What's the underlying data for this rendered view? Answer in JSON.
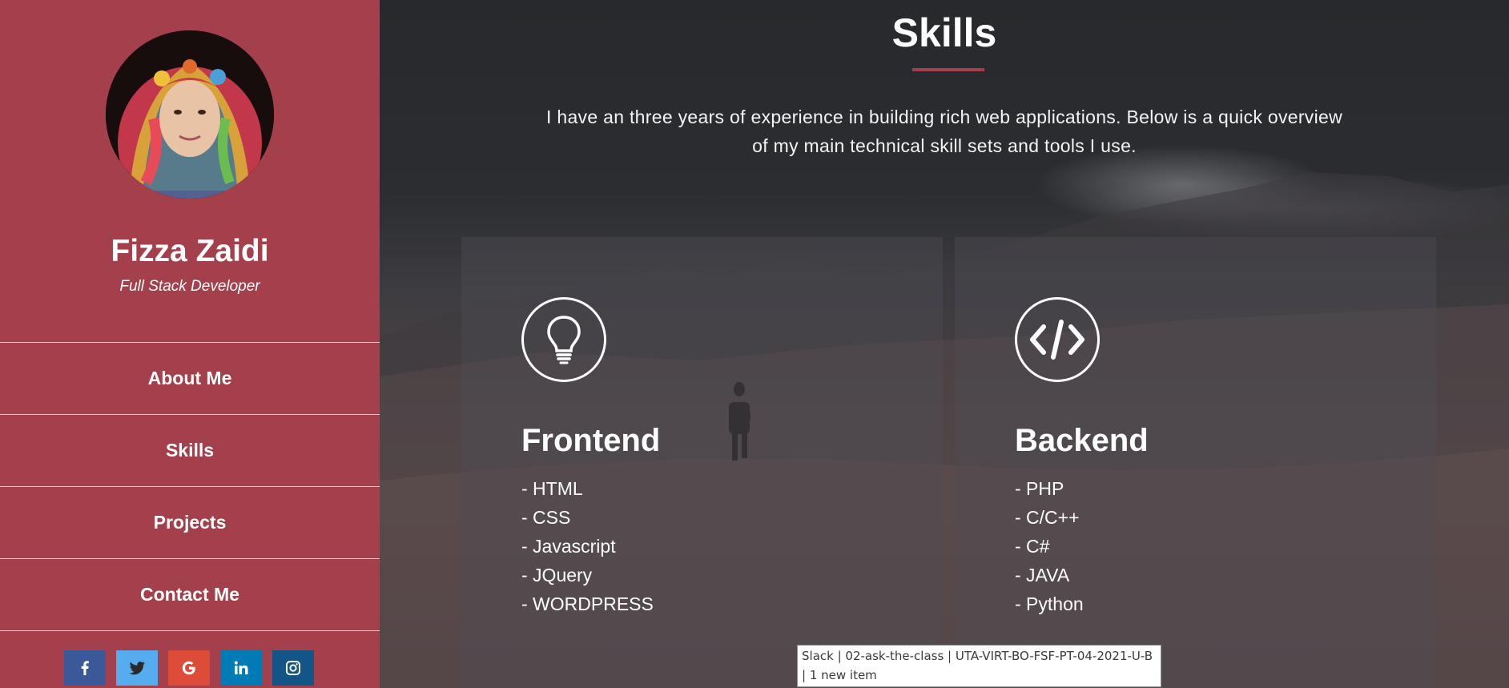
{
  "sidebar": {
    "name": "Fizza Zaidi",
    "role": "Full Stack Developer",
    "nav": [
      "About Me",
      "Skills",
      "Projects",
      "Contact Me"
    ],
    "social": [
      {
        "icon": "facebook-icon",
        "color": "#3b5998"
      },
      {
        "icon": "twitter-icon",
        "color": "#55acee"
      },
      {
        "icon": "google-icon",
        "color": "#dd4b39"
      },
      {
        "icon": "linkedin-icon",
        "color": "#007bb5"
      },
      {
        "icon": "instagram-icon",
        "color": "#125688"
      }
    ],
    "background": "#a3404b"
  },
  "skills": {
    "title": "Skills",
    "intro": "I have an three years of experience in building rich web applications. Below is a quick overview of my main technical skill sets and tools I use.",
    "frontend": {
      "icon": "lightbulb-icon",
      "title": "Frontend",
      "items": [
        "- HTML",
        "- CSS",
        "- Javascript",
        "- JQuery",
        "- WORDPRESS"
      ]
    },
    "backend": {
      "icon": "code-icon",
      "title": "Backend",
      "items": [
        "- PHP",
        "- C/C++",
        "- C#",
        "- JAVA",
        "- Python"
      ]
    }
  },
  "tooltip": {
    "text": "Slack | 02-ask-the-class | UTA-VIRT-BO-FSF-PT-04-2021-U-B | 1 new item"
  }
}
